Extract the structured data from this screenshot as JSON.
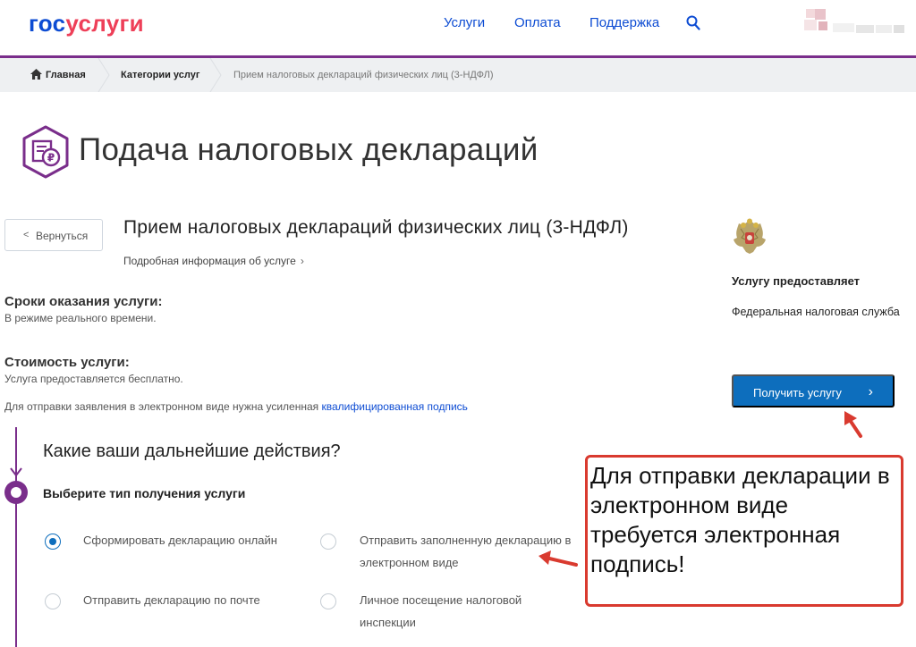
{
  "header": {
    "logo_part1": "гос",
    "logo_part2": "услуги",
    "nav": [
      "Услуги",
      "Оплата",
      "Поддержка"
    ]
  },
  "breadcrumb": [
    "Главная",
    "Категории услуг",
    "Прием налоговых деклараций физических лиц (3-НДФЛ)"
  ],
  "page_title": "Подача налоговых деклараций",
  "back_label": "Вернуться",
  "service": {
    "title": "Прием налоговых деклараций физических лиц (3-НДФЛ)",
    "details_link": "Подробная информация об услуге"
  },
  "terms": {
    "heading": "Сроки оказания услуги:",
    "value": "В режиме реального времени."
  },
  "cost": {
    "heading": "Стоимость услуги:",
    "value": "Услуга предоставляется бесплатно."
  },
  "signature_note": {
    "text": "Для отправки заявления в электронном виде нужна усиленная",
    "link": "квалифицированная подпись"
  },
  "provider": {
    "label": "Услугу предоставляет",
    "name": "Федеральная налоговая служба"
  },
  "get_service_label": "Получить услугу",
  "next_steps": {
    "question": "Какие ваши дальнейшие действия?",
    "step_label": "Выберите тип получения услуги",
    "options": [
      {
        "label": "Сформировать декларацию онлайн",
        "checked": true
      },
      {
        "label": "Отправить заполненную декларацию в электронном виде",
        "checked": false
      },
      {
        "label": "Отправить декларацию по почте",
        "checked": false
      },
      {
        "label": "Личное посещение налоговой инспекции",
        "checked": false
      }
    ]
  },
  "annotation": {
    "text": "Для отправки декларации в электронном виде требуется электронная подпись!",
    "color": "#d93a2f"
  },
  "colors": {
    "brand_blue": "#0d4cd3",
    "brand_red": "#ee3f58",
    "accent_purple": "#7a2e8b",
    "button_blue": "#0d6ebd"
  }
}
